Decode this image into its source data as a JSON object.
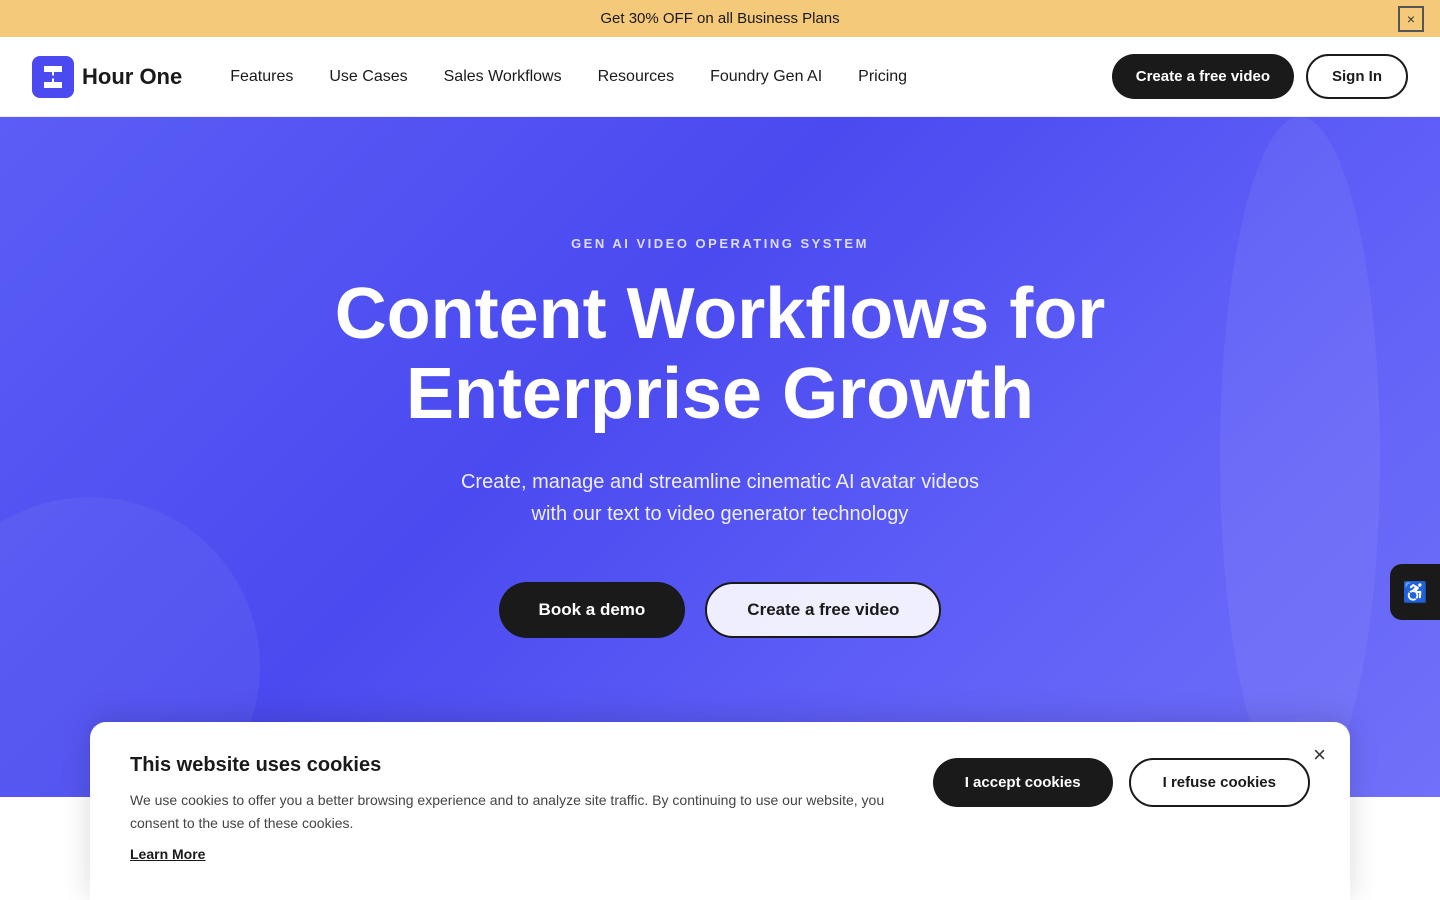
{
  "banner": {
    "text": "Get 30% OFF on all Business Plans",
    "close_label": "×"
  },
  "navbar": {
    "logo_text": "Hour One",
    "links": [
      {
        "label": "Features",
        "id": "features"
      },
      {
        "label": "Use Cases",
        "id": "use-cases"
      },
      {
        "label": "Sales Workflows",
        "id": "sales-workflows"
      },
      {
        "label": "Resources",
        "id": "resources"
      },
      {
        "label": "Foundry Gen AI",
        "id": "foundry-gen-ai"
      },
      {
        "label": "Pricing",
        "id": "pricing"
      }
    ],
    "create_label": "Create a free video",
    "signin_label": "Sign In"
  },
  "hero": {
    "eyebrow": "GEN AI VIDEO OPERATING SYSTEM",
    "title_line1": "Content Workflows for",
    "title_line2": "Enterprise Growth",
    "subtitle_line1": "Create, manage and streamline cinematic AI avatar videos",
    "subtitle_line2": "with our text to video generator technology",
    "book_demo_label": "Book a demo",
    "create_video_label": "Create a free video"
  },
  "accessibility": {
    "icon": "♿"
  },
  "cookie": {
    "title": "This website uses cookies",
    "text": "We use cookies to offer you a better browsing experience and to analyze site traffic. By continuing to use our website, you consent to the use of these cookies.",
    "learn_more_label": "Learn More",
    "accept_label": "I accept cookies",
    "refuse_label": "I refuse cookies",
    "close_label": "×"
  }
}
